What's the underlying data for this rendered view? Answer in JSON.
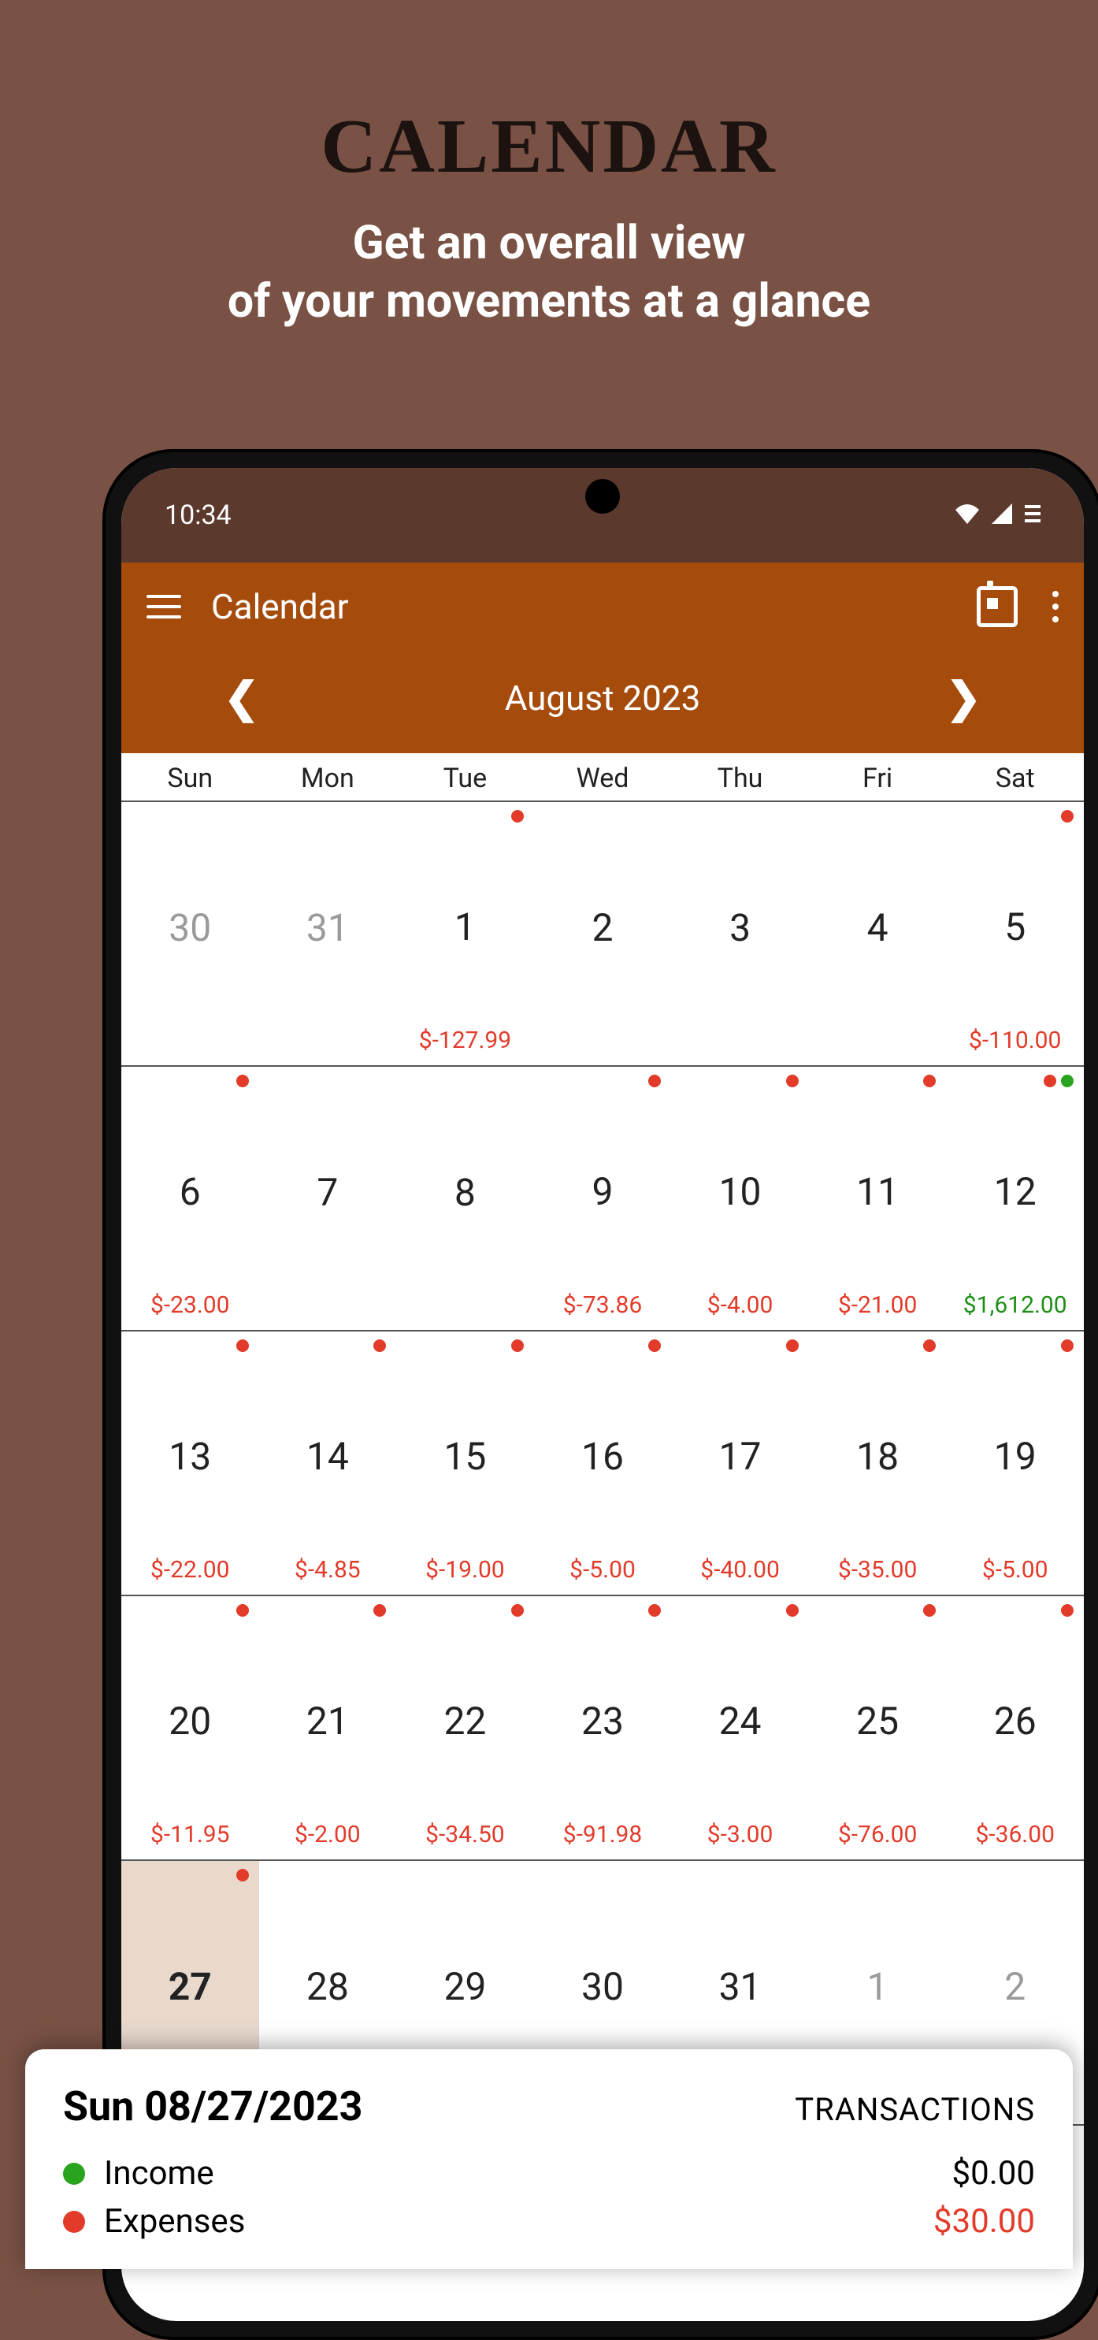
{
  "promo": {
    "title": "CALENDAR",
    "sub1": "Get an overall view",
    "sub2": "of your movements at a glance"
  },
  "status": {
    "time": "10:34"
  },
  "appbar": {
    "title": "Calendar",
    "month": "August 2023"
  },
  "dow": [
    "Sun",
    "Mon",
    "Tue",
    "Wed",
    "Thu",
    "Fri",
    "Sat"
  ],
  "weeks": [
    [
      {
        "n": "30",
        "other": true
      },
      {
        "n": "31",
        "other": true
      },
      {
        "n": "1",
        "dots": [
          "red"
        ],
        "amt": "$-127.99",
        "cls": "neg"
      },
      {
        "n": "2"
      },
      {
        "n": "3"
      },
      {
        "n": "4"
      },
      {
        "n": "5",
        "dots": [
          "red"
        ],
        "amt": "$-110.00",
        "cls": "neg"
      }
    ],
    [
      {
        "n": "6",
        "dots": [
          "red"
        ],
        "amt": "$-23.00",
        "cls": "neg"
      },
      {
        "n": "7"
      },
      {
        "n": "8"
      },
      {
        "n": "9",
        "dots": [
          "red"
        ],
        "amt": "$-73.86",
        "cls": "neg"
      },
      {
        "n": "10",
        "dots": [
          "red"
        ],
        "amt": "$-4.00",
        "cls": "neg"
      },
      {
        "n": "11",
        "dots": [
          "red"
        ],
        "amt": "$-21.00",
        "cls": "neg"
      },
      {
        "n": "12",
        "dots": [
          "red",
          "green"
        ],
        "amt": "$1,612.00",
        "cls": "pos"
      }
    ],
    [
      {
        "n": "13",
        "dots": [
          "red"
        ],
        "amt": "$-22.00",
        "cls": "neg"
      },
      {
        "n": "14",
        "dots": [
          "red"
        ],
        "amt": "$-4.85",
        "cls": "neg"
      },
      {
        "n": "15",
        "dots": [
          "red"
        ],
        "amt": "$-19.00",
        "cls": "neg"
      },
      {
        "n": "16",
        "dots": [
          "red"
        ],
        "amt": "$-5.00",
        "cls": "neg"
      },
      {
        "n": "17",
        "dots": [
          "red"
        ],
        "amt": "$-40.00",
        "cls": "neg"
      },
      {
        "n": "18",
        "dots": [
          "red"
        ],
        "amt": "$-35.00",
        "cls": "neg"
      },
      {
        "n": "19",
        "dots": [
          "red"
        ],
        "amt": "$-5.00",
        "cls": "neg"
      }
    ],
    [
      {
        "n": "20",
        "dots": [
          "red"
        ],
        "amt": "$-11.95",
        "cls": "neg"
      },
      {
        "n": "21",
        "dots": [
          "red"
        ],
        "amt": "$-2.00",
        "cls": "neg"
      },
      {
        "n": "22",
        "dots": [
          "red"
        ],
        "amt": "$-34.50",
        "cls": "neg"
      },
      {
        "n": "23",
        "dots": [
          "red"
        ],
        "amt": "$-91.98",
        "cls": "neg"
      },
      {
        "n": "24",
        "dots": [
          "red"
        ],
        "amt": "$-3.00",
        "cls": "neg"
      },
      {
        "n": "25",
        "dots": [
          "red"
        ],
        "amt": "$-76.00",
        "cls": "neg"
      },
      {
        "n": "26",
        "dots": [
          "red"
        ],
        "amt": "$-36.00",
        "cls": "neg"
      }
    ],
    [
      {
        "n": "27",
        "dots": [
          "red"
        ],
        "selected": true,
        "bold": true
      },
      {
        "n": "28"
      },
      {
        "n": "29"
      },
      {
        "n": "30"
      },
      {
        "n": "31"
      },
      {
        "n": "1",
        "other": true
      },
      {
        "n": "2",
        "other": true
      }
    ]
  ],
  "summary": {
    "date": "Sun 08/27/2023",
    "trans": "TRANSACTIONS",
    "income_label": "Income",
    "income_value": "$0.00",
    "expense_label": "Expenses",
    "expense_value": "$30.00"
  }
}
